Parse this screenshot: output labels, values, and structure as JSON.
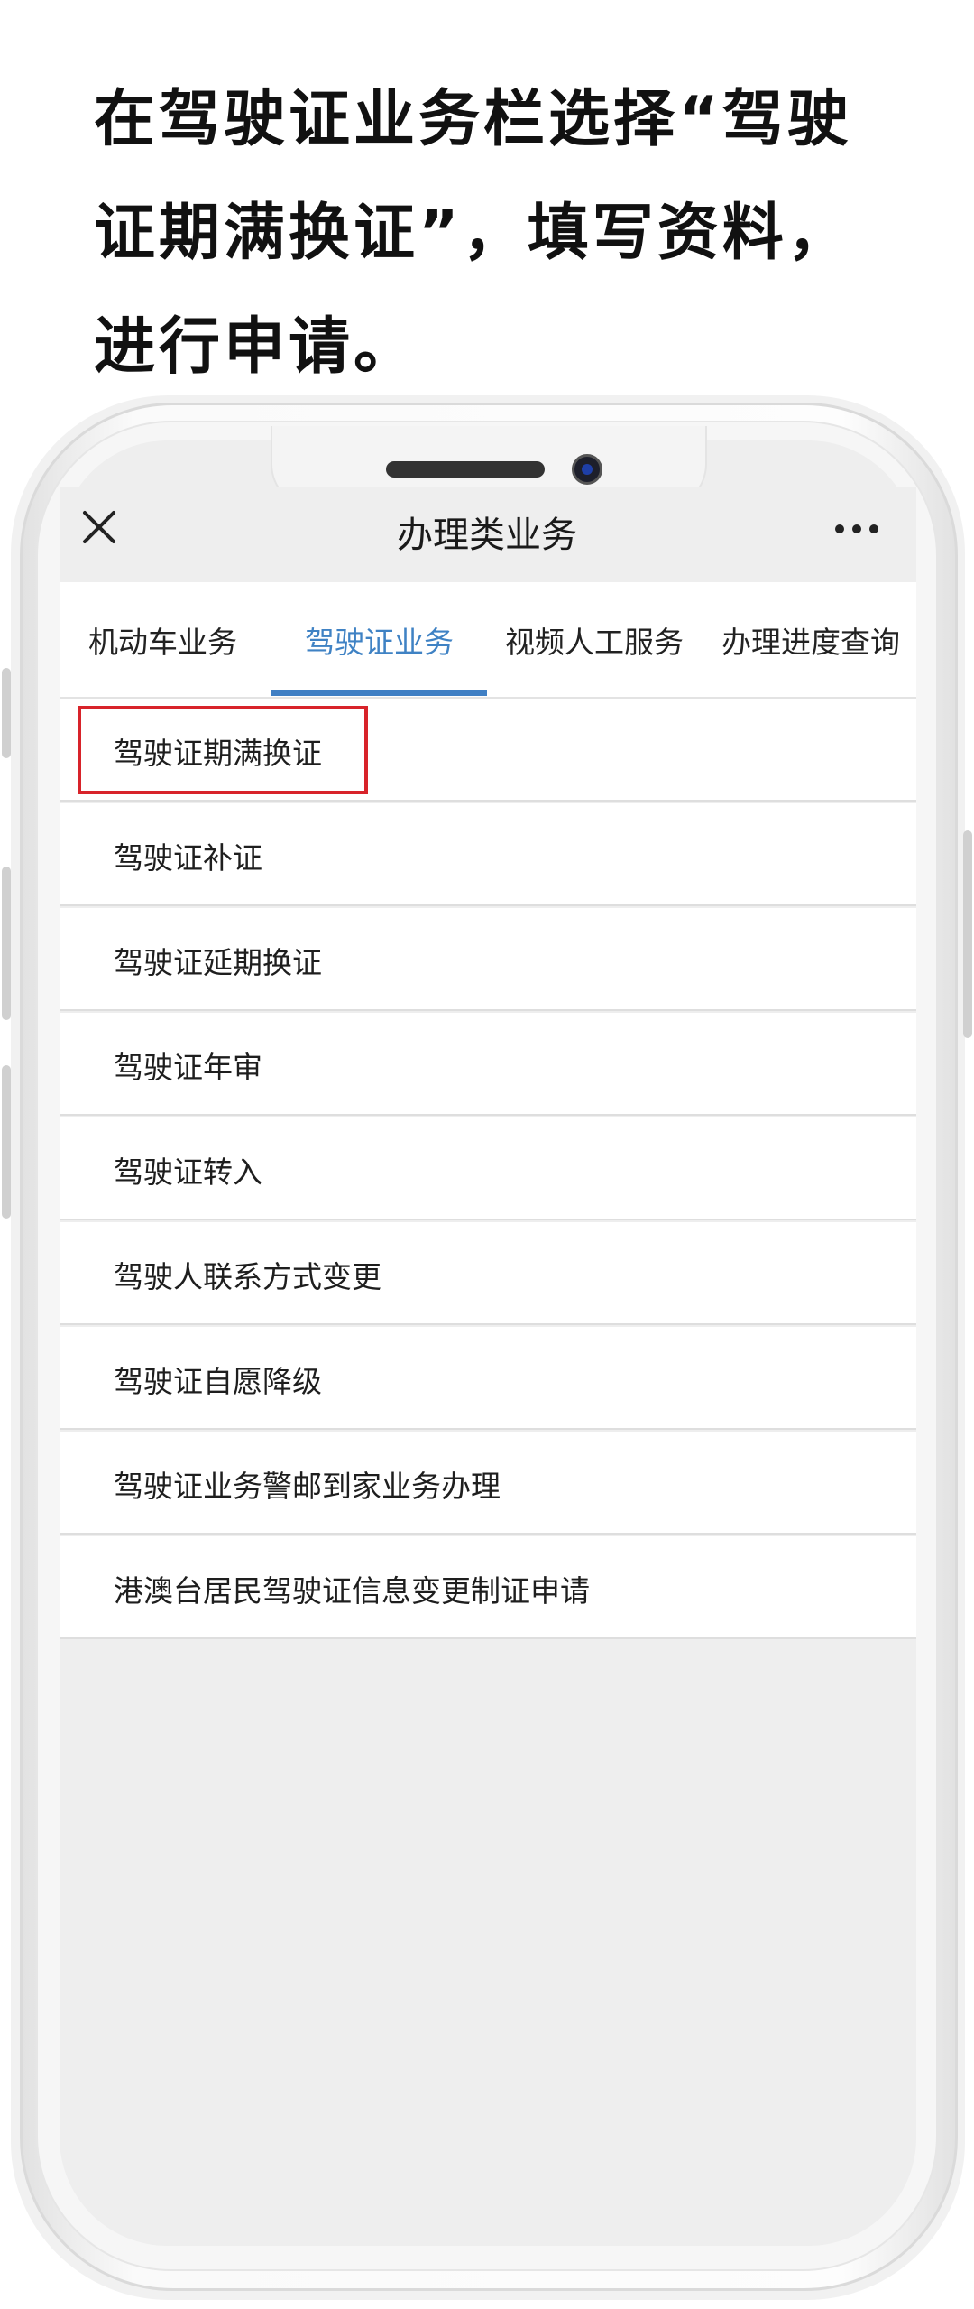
{
  "caption": {
    "line1": "在驾驶证业务栏选择“驾驶",
    "line2": "证期满换证”，填写资料，",
    "line3": "进行申请。"
  },
  "header": {
    "title": "办理类业务",
    "close_icon": "close-icon",
    "more_icon": "more-icon"
  },
  "tabs": [
    {
      "label": "机动车业务",
      "active": false
    },
    {
      "label": "驾驶证业务",
      "active": true
    },
    {
      "label": "视频人工服务",
      "active": false
    },
    {
      "label": "办理进度查询",
      "active": false
    }
  ],
  "list": {
    "items": [
      {
        "label": "驾驶证期满换证",
        "highlighted": true
      },
      {
        "label": "驾驶证补证"
      },
      {
        "label": "驾驶证延期换证"
      },
      {
        "label": "驾驶证年审"
      },
      {
        "label": "驾驶证转入"
      },
      {
        "label": "驾驶人联系方式变更"
      },
      {
        "label": "驾驶证自愿降级"
      },
      {
        "label": "驾驶证业务警邮到家业务办理"
      },
      {
        "label": "港澳台居民驾驶证信息变更制证申请"
      }
    ]
  },
  "colors": {
    "active_tab": "#3f82c4",
    "highlight_border": "#d8232a",
    "screen_background": "#eeeeee"
  }
}
